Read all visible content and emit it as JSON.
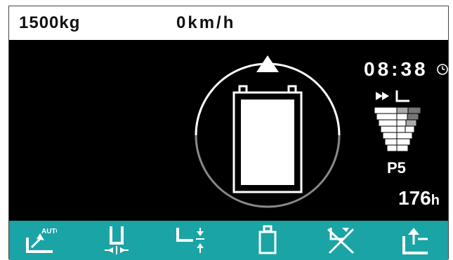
{
  "status": {
    "load": "1500kg",
    "speed": "0km/h"
  },
  "dashboard": {
    "clock": "08:38",
    "power_mode": "P5",
    "hours_value": "176",
    "hours_unit": "h"
  },
  "icons": {
    "battery": "battery-icon",
    "direction_arrow": "up-triangle-icon",
    "clock": "clock-icon",
    "gear": "speed-gear-bars-icon",
    "bottom": [
      {
        "name": "auto-tilt-icon",
        "label": "AUTO"
      },
      {
        "name": "fork-spread-icon"
      },
      {
        "name": "fork-height-icon"
      },
      {
        "name": "load-weight-icon"
      },
      {
        "name": "disabled-function-icon"
      },
      {
        "name": "lift-up-icon"
      }
    ]
  },
  "colors": {
    "panel_bg": "#000000",
    "bar_accent": "#1aa4a6",
    "text": "#ffffff"
  }
}
